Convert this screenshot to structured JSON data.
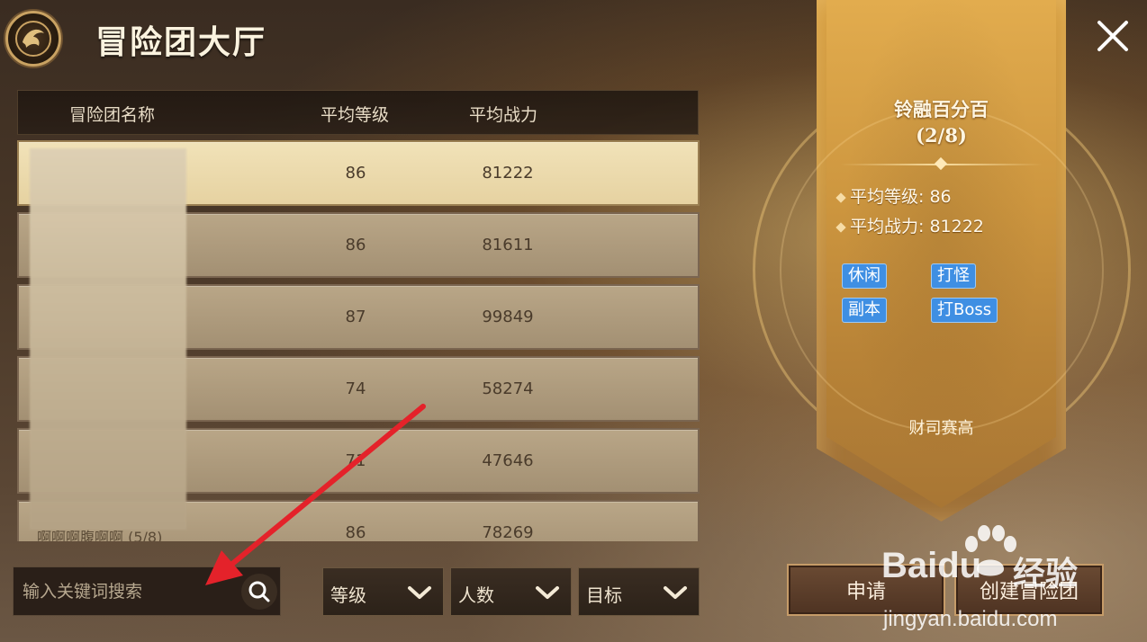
{
  "header": {
    "title": "冒险团大厅",
    "emblem_icon": "dragon-emblem-icon",
    "close_icon": "close-icon"
  },
  "table": {
    "columns": {
      "name": "冒险团名称",
      "avg_level": "平均等级",
      "avg_power": "平均战力"
    },
    "rows": [
      {
        "name": "",
        "avg_level": "86",
        "avg_power": "81222",
        "selected": true
      },
      {
        "name": "",
        "avg_level": "86",
        "avg_power": "81611"
      },
      {
        "name": "",
        "avg_level": "87",
        "avg_power": "99849"
      },
      {
        "name": "",
        "avg_level": "74",
        "avg_power": "58274"
      },
      {
        "name": "",
        "avg_level": "71",
        "avg_power": "47646"
      },
      {
        "name": "啊啊啊腹啊啊 (5/8)",
        "avg_level": "86",
        "avg_power": "78269"
      }
    ]
  },
  "search": {
    "placeholder": "输入关键词搜索",
    "value": "",
    "icon": "search-icon"
  },
  "filters": [
    {
      "label": "等级"
    },
    {
      "label": "人数"
    },
    {
      "label": "目标"
    }
  ],
  "detail": {
    "team_name": "铃融百分百",
    "member_count": "(2/8)",
    "avg_level_text": "平均等级: 86",
    "avg_power_text": "平均战力: 81222",
    "tags": [
      "休闲",
      "打怪",
      "副本",
      "打Boss"
    ],
    "motto": "财司赛高"
  },
  "buttons": {
    "apply": "申请",
    "create": "创建冒险团"
  },
  "watermark": {
    "brand": "Baidu",
    "cn": "经验",
    "url": "jingyan.baidu.com"
  },
  "colors": {
    "tag_blue": "#3f8fe3",
    "arrow_red": "#e4222a",
    "selected_row": "#f1e2b8"
  }
}
